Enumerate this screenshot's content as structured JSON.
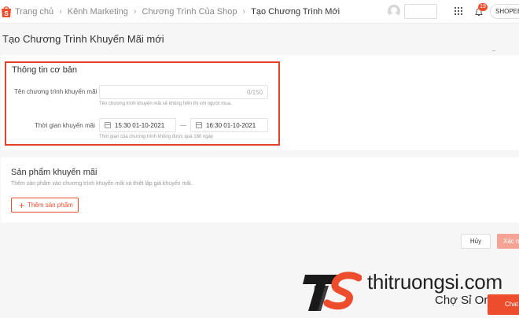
{
  "breadcrumb": {
    "items": [
      "Trang chủ",
      "Kênh Marketing",
      "Chương Trình Của Shop",
      "Tạo Chương Trình Mới"
    ]
  },
  "header": {
    "notification_count": "19",
    "shop_label": "SHOPEE"
  },
  "page": {
    "title": "Tạo Chương Trình Khuyến Mãi mới"
  },
  "basic_info": {
    "title": "Thông tin cơ bản",
    "name_label": "Tên chương trình khuyến mãi",
    "name_value": "",
    "name_counter": "0/150",
    "name_hint": "Tên chương trình khuyến mãi sẽ không hiển thị với người mua.",
    "time_label": "Thời gian khuyến mãi",
    "start_time": "15:30 01-10-2021",
    "end_time": "16:30 01-10-2021",
    "time_hint": "Thời gian của chương trình không được quá 180 ngày"
  },
  "products": {
    "title": "Sản phẩm khuyến mãi",
    "description": "Thêm sản phẩm vào chương trình khuyến mãi và thiết lập giá khuyến mãi.",
    "add_button": "Thêm sản phẩm"
  },
  "actions": {
    "cancel": "Hủy",
    "confirm": "Xác nhận"
  },
  "watermark": {
    "title": "thitruongsi.com",
    "subtitle": "Chợ Sỉ Online"
  },
  "chat": {
    "label": "Chat"
  },
  "colors": {
    "brand": "#ee4d2d",
    "highlight": "#e7402a"
  }
}
